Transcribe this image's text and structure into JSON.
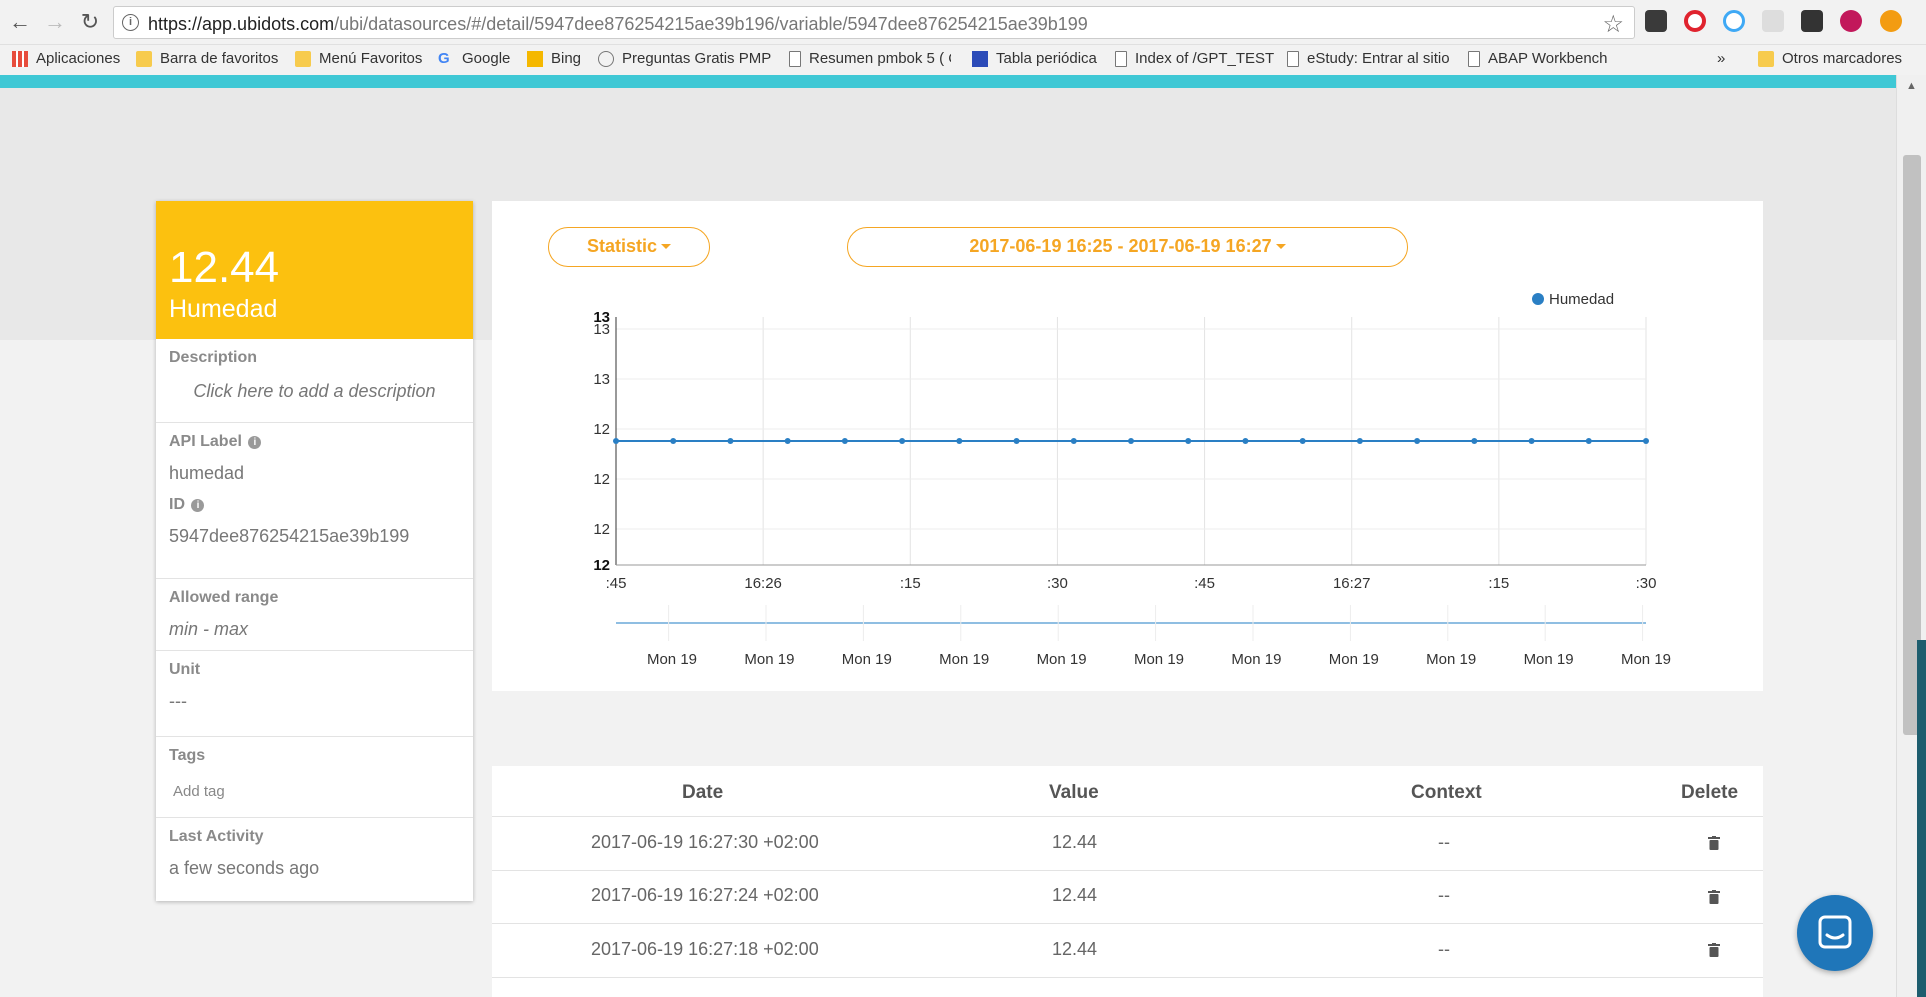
{
  "browser": {
    "url_host": "https://app.ubidots.com",
    "url_path": "/ubi/datasources/#/detail/5947dee876254215ae39b196/variable/5947dee876254215ae39b199",
    "bookmarks": [
      {
        "label": "Aplicaciones",
        "icon": "apps-icon"
      },
      {
        "label": "Barra de favoritos",
        "icon": "folder-icon"
      },
      {
        "label": "Menú Favoritos",
        "icon": "folder-icon"
      },
      {
        "label": "Google",
        "icon": "google-icon"
      },
      {
        "label": "Bing",
        "icon": "bing-icon"
      },
      {
        "label": "Preguntas Gratis PMP",
        "icon": "wordpress-icon"
      },
      {
        "label": "Resumen pmbok 5 ( C",
        "icon": "page-icon"
      },
      {
        "label": "Tabla periódica",
        "icon": "pt-icon"
      },
      {
        "label": "Index of /GPT_TEST",
        "icon": "page-icon"
      },
      {
        "label": "eStudy: Entrar al sitio",
        "icon": "page-icon"
      },
      {
        "label": "ABAP Workbench",
        "icon": "page-icon"
      }
    ],
    "more_label": "»",
    "other_bookmarks": "Otros marcadores"
  },
  "variable": {
    "value": "12.44",
    "name": "Humedad",
    "description_label": "Description",
    "description_placeholder": "Click here to add a description",
    "api_label_label": "API Label",
    "api_label": "humedad",
    "id_label": "ID",
    "id": "5947dee876254215ae39b199",
    "allowed_range_label": "Allowed range",
    "allowed_range": "min - max",
    "unit_label": "Unit",
    "unit": "---",
    "tags_label": "Tags",
    "add_tag": "Add tag",
    "last_activity_label": "Last Activity",
    "last_activity": "a few seconds ago"
  },
  "controls": {
    "statistic": "Statistic",
    "date_range": "2017-06-19 16:25 - 2017-06-19 16:27"
  },
  "chart_data": {
    "type": "line",
    "series": [
      {
        "name": "Humedad",
        "values": [
          12.44,
          12.44,
          12.44,
          12.44,
          12.44,
          12.44,
          12.44,
          12.44,
          12.44,
          12.44,
          12.44,
          12.44,
          12.44,
          12.44,
          12.44,
          12.44,
          12.44,
          12.44,
          12.44
        ]
      }
    ],
    "x_tick_labels": [
      ":45",
      "16:26",
      ":15",
      ":30",
      ":45",
      "16:27",
      ":15",
      ":30"
    ],
    "y_tick_labels": [
      "13",
      "13",
      "13",
      "12",
      "12",
      "12",
      "12"
    ],
    "navigator_labels": [
      "Mon 19",
      "Mon 19",
      "Mon 19",
      "Mon 19",
      "Mon 19",
      "Mon 19",
      "Mon 19",
      "Mon 19",
      "Mon 19",
      "Mon 19",
      "Mon 19"
    ],
    "legend_position": "top-right",
    "color": "#2a7fc4",
    "grid": true
  },
  "table": {
    "headers": [
      "Date",
      "Value",
      "Context",
      "Delete"
    ],
    "rows": [
      {
        "date": "2017-06-19 16:27:30 +02:00",
        "value": "12.44",
        "context": "--"
      },
      {
        "date": "2017-06-19 16:27:24 +02:00",
        "value": "12.44",
        "context": "--"
      },
      {
        "date": "2017-06-19 16:27:18 +02:00",
        "value": "12.44",
        "context": "--"
      }
    ]
  }
}
